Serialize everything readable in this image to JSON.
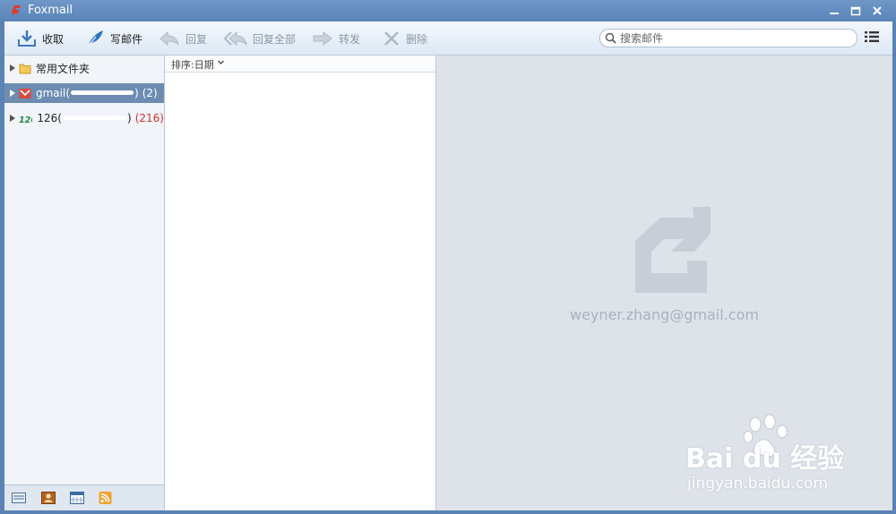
{
  "app": {
    "title": "Foxmail"
  },
  "toolbar": {
    "receive": "收取",
    "compose": "写邮件",
    "reply": "回复",
    "reply_all": "回复全部",
    "forward": "转发",
    "delete": "删除"
  },
  "search": {
    "placeholder": "搜索邮件"
  },
  "sidebar": {
    "items": [
      {
        "label": "常用文件夹",
        "count": ""
      },
      {
        "label": "gmail(",
        "suffix": ")",
        "count": "(2)"
      },
      {
        "label": "126(",
        "suffix": ")",
        "count": "(216)"
      }
    ]
  },
  "maillist": {
    "sort_label": "排序:日期"
  },
  "preview": {
    "account_email": "weyner.zhang@gmail.com"
  },
  "watermark": {
    "main": "Bai du 经验",
    "sub": "jingyan.baidu.com"
  },
  "colors": {
    "accent": "#6d8cb2",
    "unread_red": "#d23232"
  }
}
